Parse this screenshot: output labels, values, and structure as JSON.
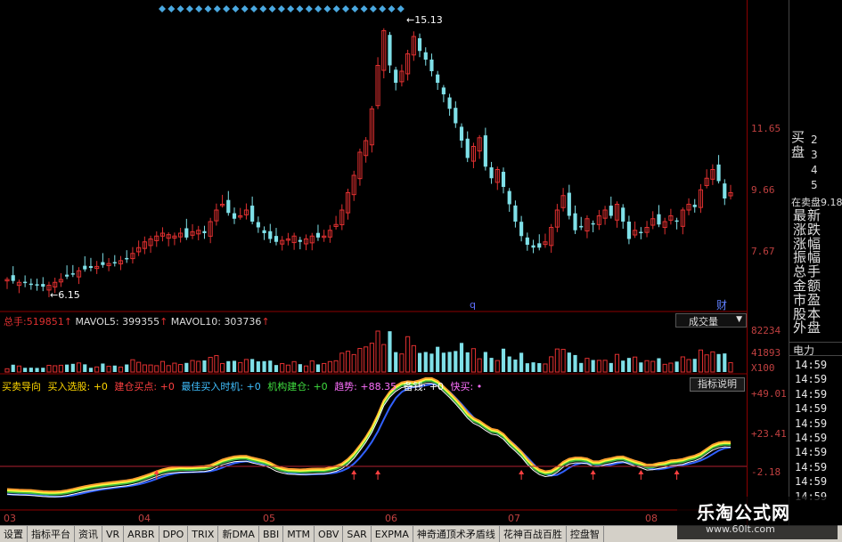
{
  "price_axis": [
    "11.65",
    "9.66",
    "7.67"
  ],
  "volume_axis": [
    "82234",
    "41893",
    "X100"
  ],
  "indicator_axis": [
    "+49.01",
    "+23.41",
    "-2.18"
  ],
  "high_label": "15.13",
  "low_label": "6.15",
  "chart_marker": "q",
  "finance_marker": "财",
  "volume_header": {
    "vol_label": "总手:",
    "vol_value": "519851",
    "ma5_label": "MAVOL5:",
    "ma5_value": "399355",
    "ma10_label": "MAVOL10:",
    "ma10_value": "303736"
  },
  "volume_selector": "成交量",
  "indicator_header": {
    "name": "买卖导向",
    "item1": "买入选股: +0",
    "item2": "建仓买点: +0",
    "item3": "最佳买入时机: +0",
    "item4": "机构建仓: +0",
    "item5": "趋势: +88.35",
    "item6": "备钱: +0",
    "item7": "快买: •"
  },
  "indicator_button": "指标说明",
  "dates": [
    "03",
    "04",
    "05",
    "06",
    "07",
    "08"
  ],
  "right_panel": {
    "buy_title": "买盘",
    "buy_numbers": [
      "2",
      "3",
      "4",
      "5"
    ],
    "outer_label": "在卖盘9.18",
    "menu": [
      "最新",
      "涨跌",
      "涨幅",
      "振幅",
      "总手",
      "金额",
      "市盈",
      "股本",
      "外盘"
    ],
    "power": "电力",
    "times": [
      "14:59",
      "14:59",
      "14:59",
      "14:59",
      "14:59",
      "14:59",
      "14:59",
      "14:59",
      "14:59",
      "14:59"
    ]
  },
  "tabs": [
    "设置",
    "指标平台",
    "资讯",
    "VR",
    "ARBR",
    "DPO",
    "TRIX",
    "新DMA",
    "BBI",
    "MTM",
    "OBV",
    "SAR",
    "EXPMA",
    "神奇通顶术矛盾线",
    "花神百战百胜",
    "控盘智"
  ],
  "watermark": {
    "logo": "乐淘公式网",
    "url": "www.60lt.com"
  },
  "colors": {
    "up": "#e03030",
    "down": "#7fe0e8",
    "axis": "#c04040",
    "grid": "#8b0000"
  },
  "chart_data": {
    "type": "candlestick",
    "price_range": [
      5.6,
      15.6
    ],
    "closes": [
      6.4,
      6.35,
      6.3,
      6.3,
      6.25,
      6.2,
      6.15,
      6.2,
      6.3,
      6.4,
      6.5,
      6.6,
      6.7,
      6.75,
      6.8,
      6.85,
      6.9,
      6.95,
      7.0,
      7.05,
      7.1,
      7.3,
      7.5,
      7.7,
      7.8,
      7.9,
      8.0,
      7.95,
      7.9,
      8.0,
      7.85,
      8.05,
      8.1,
      8.0,
      8.4,
      8.8,
      9.0,
      8.7,
      8.5,
      8.6,
      8.8,
      8.4,
      8.2,
      8.0,
      7.8,
      7.7,
      7.75,
      7.8,
      7.9,
      7.7,
      7.8,
      7.9,
      7.85,
      7.9,
      8.1,
      8.3,
      8.8,
      9.4,
      10.0,
      10.8,
      11.2,
      12.3,
      13.8,
      15.0,
      13.8,
      13.2,
      13.6,
      14.2,
      14.8,
      14.3,
      14.0,
      13.6,
      13.2,
      12.8,
      12.3,
      11.8,
      11.2,
      10.6,
      11.0,
      11.3,
      10.3,
      9.9,
      10.2,
      9.6,
      9.0,
      8.4,
      7.9,
      7.6,
      7.5,
      7.5,
      7.7,
      8.2,
      8.8,
      9.3,
      8.6,
      8.1,
      8.2,
      8.5,
      8.3,
      8.6,
      8.8,
      8.6,
      9.0,
      8.4,
      7.8,
      8.1,
      8.0,
      8.2,
      8.5,
      8.3,
      8.4,
      8.6,
      8.4,
      8.8,
      9.0,
      8.9,
      9.5,
      9.9,
      10.2,
      9.8,
      9.2,
      9.4
    ],
    "volume_range": [
      0,
      82234
    ],
    "indicator_range": [
      -20,
      49.01
    ]
  }
}
